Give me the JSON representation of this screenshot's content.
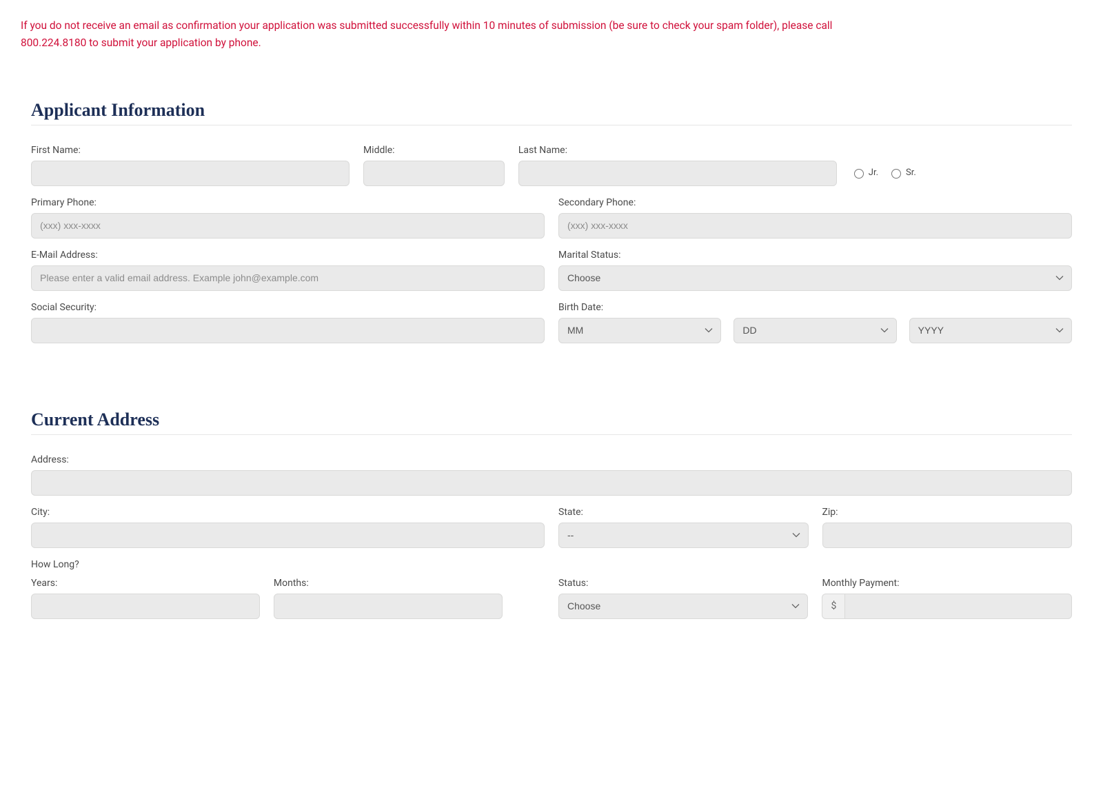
{
  "warning_text": "If you do not receive an email as confirmation your application was submitted successfully within 10 minutes of submission (be sure to check your spam folder), please call 800.224.8180 to submit your application by phone.",
  "sections": {
    "applicant": {
      "title": "Applicant Information"
    },
    "address": {
      "title": "Current Address"
    }
  },
  "applicant": {
    "first_name_label": "First Name:",
    "middle_label": "Middle:",
    "last_name_label": "Last Name:",
    "suffix_jr": "Jr.",
    "suffix_sr": "Sr.",
    "primary_phone_label": "Primary Phone:",
    "secondary_phone_label": "Secondary Phone:",
    "phone_placeholder": "(xxx) xxx-xxxx",
    "email_label": "E-Mail Address:",
    "email_placeholder": "Please enter a valid email address. Example john@example.com",
    "marital_label": "Marital Status:",
    "marital_selected": "Choose",
    "ssn_label": "Social Security:",
    "birth_label": "Birth Date:",
    "birth_mm": "MM",
    "birth_dd": "DD",
    "birth_yyyy": "YYYY"
  },
  "address": {
    "address_label": "Address:",
    "city_label": "City:",
    "state_label": "State:",
    "state_selected": "--",
    "zip_label": "Zip:",
    "how_long_label": "How Long?",
    "years_label": "Years:",
    "months_label": "Months:",
    "status_label": "Status:",
    "status_selected": "Choose",
    "monthly_payment_label": "Monthly Payment:",
    "currency_addon": "$"
  }
}
